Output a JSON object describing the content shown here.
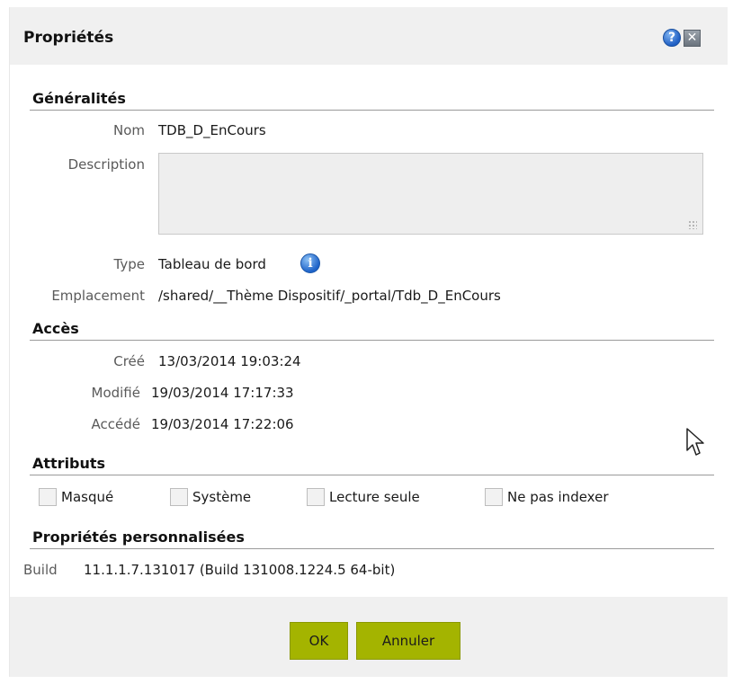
{
  "dialog": {
    "title": "Propriétés",
    "help_icon": "help-icon",
    "close_icon": "close-icon"
  },
  "general": {
    "section_title": "Généralités",
    "name_label": "Nom",
    "name_value": "TDB_D_EnCours",
    "description_label": "Description",
    "description_value": "",
    "type_label": "Type",
    "type_value": "Tableau de bord",
    "location_label": "Emplacement",
    "location_value": "/shared/__Thème Dispositif/_portal/Tdb_D_EnCours"
  },
  "access": {
    "section_title": "Accès",
    "created_label": "Créé",
    "created_value": "13/03/2014 19:03:24",
    "modified_label": "Modifié",
    "modified_value": "19/03/2014 17:17:33",
    "accessed_label": "Accédé",
    "accessed_value": "19/03/2014 17:22:06"
  },
  "attributes": {
    "section_title": "Attributs",
    "items": [
      {
        "label": "Masqué",
        "checked": false
      },
      {
        "label": "Système",
        "checked": false
      },
      {
        "label": "Lecture seule",
        "checked": false
      },
      {
        "label": "Ne pas indexer",
        "checked": false
      }
    ]
  },
  "custom": {
    "section_title": "Propriétés personnalisées",
    "build_label": "Build",
    "build_value": "11.1.1.7.131017 (Build 131008.1224.5 64-bit)"
  },
  "footer": {
    "ok_label": "OK",
    "cancel_label": "Annuler"
  },
  "colors": {
    "button_accent": "#a4b400",
    "titlebar_bg": "#f0f0f0",
    "info_blue": "#1e63c9"
  }
}
